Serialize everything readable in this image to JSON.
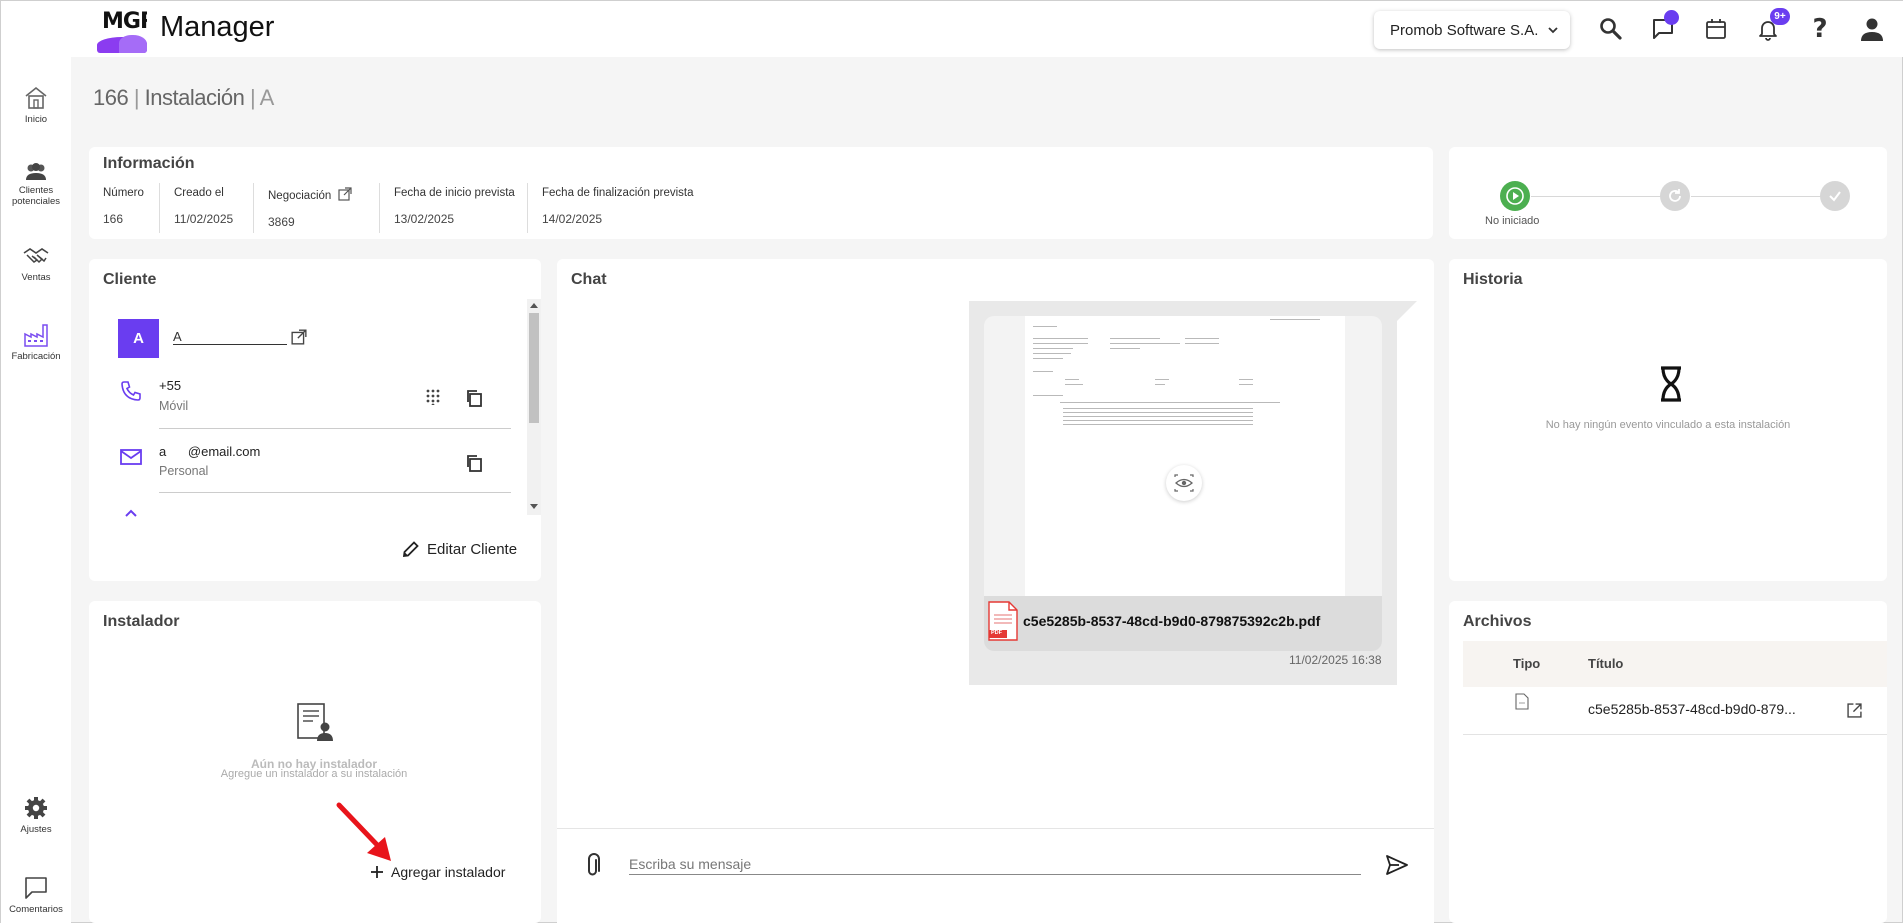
{
  "app": {
    "logo_text": "MGR",
    "title": "Manager",
    "company": "Promob Software S.A.",
    "notifications_badge": "9+"
  },
  "sidebar": {
    "items": [
      {
        "label": "Inicio",
        "icon": "home-icon"
      },
      {
        "label": "Clientes potenciales",
        "icon": "users-icon"
      },
      {
        "label": "Ventas",
        "icon": "handshake-icon"
      },
      {
        "label": "Fabricación",
        "icon": "factory-icon"
      },
      {
        "label": "Ajustes",
        "icon": "gear-icon"
      },
      {
        "label": "Comentarios",
        "icon": "comment-icon"
      }
    ]
  },
  "header": {
    "number": "166",
    "sep1": " | ",
    "type": "Instalación",
    "sep2": " | ",
    "name": "A"
  },
  "info": {
    "title": "Información",
    "fields": [
      {
        "label": "Número",
        "value": "166"
      },
      {
        "label": "Creado el",
        "value": "11/02/2025"
      },
      {
        "label": "Negociación",
        "value": "3869"
      },
      {
        "label": "Fecha de inicio prevista",
        "value": "13/02/2025"
      },
      {
        "label": "Fecha de finalización prevista",
        "value": "14/02/2025"
      }
    ]
  },
  "status": {
    "current_label": "No iniciado",
    "colors": {
      "active": "#4caf50",
      "inactive": "#d6d6d6"
    }
  },
  "client": {
    "title": "Cliente",
    "avatar_letter": "A",
    "name": "A",
    "phone": "+55",
    "phone_type": "Móvil",
    "email": "a      @email.com",
    "email_type": "Personal",
    "edit_label": "Editar Cliente"
  },
  "installer": {
    "title": "Instalador",
    "empty_title": "Aún no hay instalador",
    "empty_sub": "Agregue un instalador a su instalación",
    "add_label": "Agregar instalador"
  },
  "chat": {
    "title": "Chat",
    "file_name": "c5e5285b-8537-48cd-b9d0-879875392c2b.pdf",
    "timestamp": "11/02/2025 16:38",
    "input_placeholder": "Escriba su mensaje",
    "pdf_badge": "PDF"
  },
  "history": {
    "title": "Historia",
    "empty": "No hay ningún evento vinculado a esta instalación"
  },
  "files": {
    "title": "Archivos",
    "col_type": "Tipo",
    "col_title": "Título",
    "rows": [
      {
        "title": "c5e5285b-8537-48cd-b9d0-879..."
      }
    ]
  },
  "colors": {
    "accent": "#6a3df0",
    "brand_purple": "#8b3cf0",
    "pdf_red": "#e53935",
    "annotation_arrow": "#e8141b"
  }
}
